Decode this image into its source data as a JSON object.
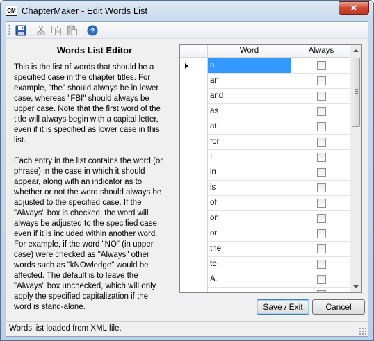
{
  "window": {
    "app_icon_text": "CM",
    "title": "ChapterMaker - Edit Words List",
    "close_glyph": "✕"
  },
  "toolbar": {
    "items": [
      "save-icon",
      "cut-icon",
      "copy-icon",
      "paste-icon",
      "help-icon"
    ]
  },
  "editor": {
    "title": "Words List Editor",
    "paragraph1": "This is the list of words that should be a\nspecified case in the chapter titles.  For\nexample, \"the\" should always be in lower\ncase, whereas \"FBI\" should always be\nupper case.  Note that the first word of the\ntitle will always begin with a capital letter,\neven if it is specified as lower case in this\nlist.",
    "paragraph2": "Each entry in the list contains the word (or\nphrase) in the case in which it should\nappear, along with an indicator as to\nwhether or not the word should always be\nadjusted to the specified case.  If the\n\"Always\" box is checked, the word will\nalways be adjusted to the specified case,\neven if it is included within another word.\nFor example, if the word \"NO\" (in upper\ncase) were checked as \"Always\" other\nwords such as \"kNOwledge\" would be\naffected.  The default is to leave the\n\"Always\" box unchecked, which will only\napply the specified capitalization if the\nword is stand-alone."
  },
  "grid": {
    "columns": [
      "Word",
      "Always"
    ],
    "rows": [
      {
        "word": "a",
        "always": false,
        "selected": true
      },
      {
        "word": "an",
        "always": false
      },
      {
        "word": "and",
        "always": false
      },
      {
        "word": "as",
        "always": false
      },
      {
        "word": "at",
        "always": false
      },
      {
        "word": "for",
        "always": false
      },
      {
        "word": "I",
        "always": false
      },
      {
        "word": "in",
        "always": false
      },
      {
        "word": "is",
        "always": false
      },
      {
        "word": "of",
        "always": false
      },
      {
        "word": "on",
        "always": false
      },
      {
        "word": "or",
        "always": false
      },
      {
        "word": "the",
        "always": false
      },
      {
        "word": "to",
        "always": false
      },
      {
        "word": "A.",
        "always": false
      },
      {
        "word": "",
        "always": false
      }
    ]
  },
  "buttons": {
    "save_exit": "Save / Exit",
    "cancel": "Cancel"
  },
  "status": {
    "text": "Words list loaded from XML file."
  },
  "colors": {
    "selection": "#3399ff",
    "close_button": "#c13b24"
  }
}
